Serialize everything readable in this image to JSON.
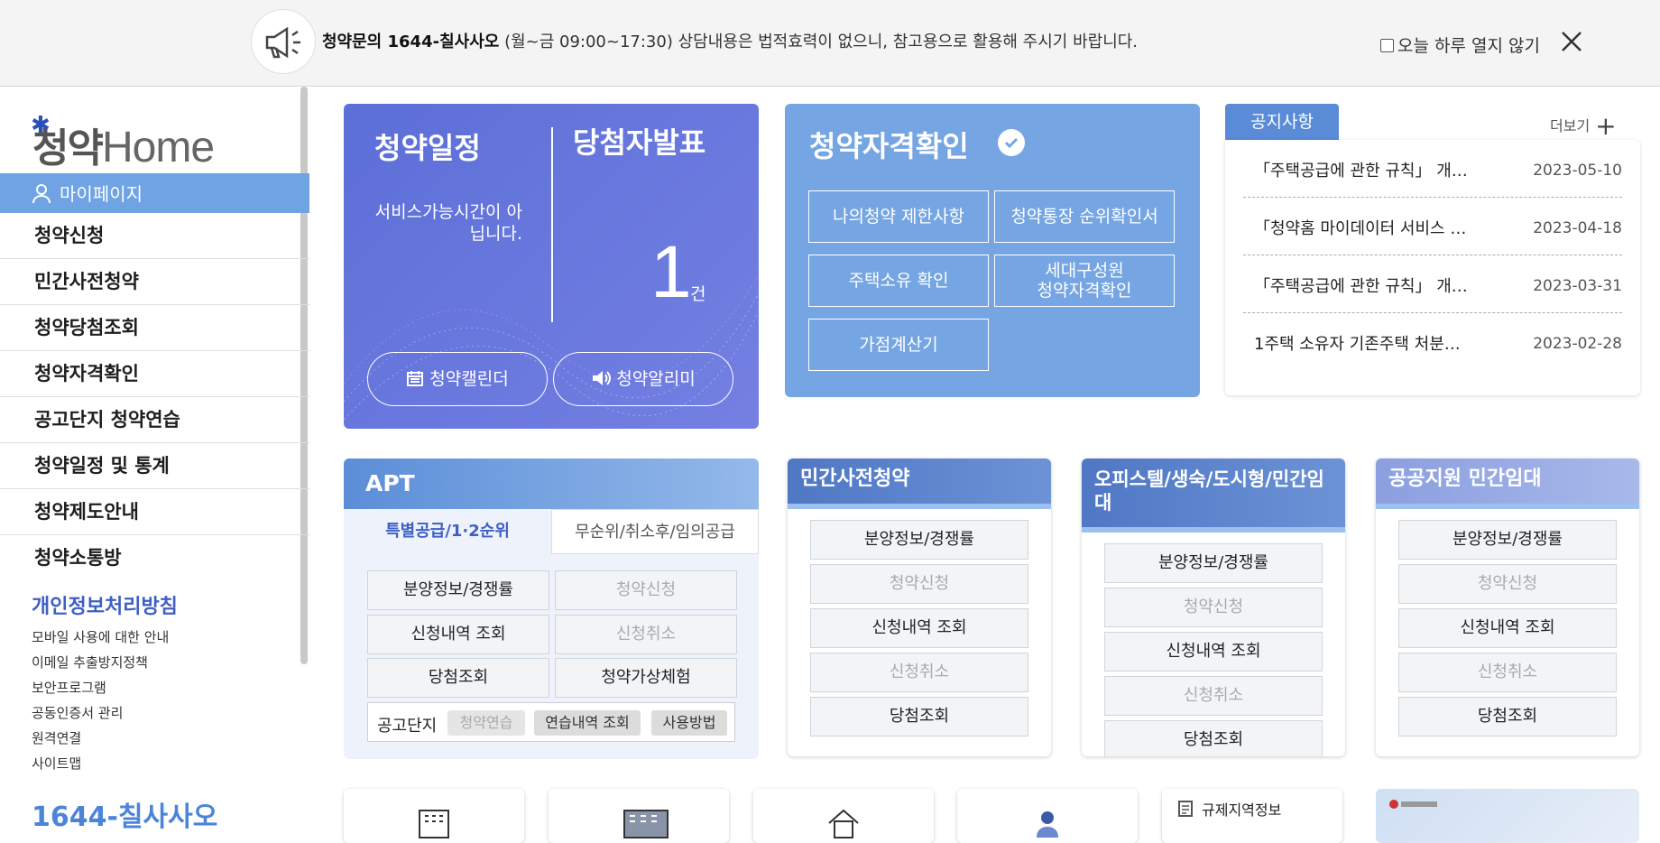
{
  "notice_bar": {
    "bold": "청약문의 1644-칠사사오",
    "hours": "(월~금 09:00~17:30)",
    "rest": " 상담내용은 법적효력이 없으니, 참고용으로 활용해 주시기 바랍니다.",
    "no_show_label": "오늘 하루 열지 않기"
  },
  "sidebar": {
    "logo_part1": "청약",
    "logo_part2": "Home",
    "mypage": "마이페이지",
    "items": [
      "청약신청",
      "민간사전청약",
      "청약당첨조회",
      "청약자격확인",
      "공고단지 청약연습",
      "청약일정 및 통계",
      "청약제도안내",
      "청약소통방"
    ],
    "policy": "개인정보처리방침",
    "links": [
      "모바일 사용에 대한 안내",
      "이메일 추출방지정책",
      "보안프로그램",
      "공동인증서 관리",
      "원격연결",
      "사이트맵"
    ],
    "phone": "1644-칠사사오"
  },
  "schedule_card": {
    "title": "청약일정",
    "winner_title": "당첨자발표",
    "message": "서비스가능시간이 아닙니다.",
    "count": "1",
    "count_unit": "건",
    "calendar_btn": "청약캘린더",
    "alarm_btn": "청약알리미"
  },
  "qualification_card": {
    "title": "청약자격확인",
    "buttons": [
      "나의청약 제한사항",
      "청약통장 순위확인서",
      "주택소유 확인",
      "세대구성원\n청약자격확인",
      "가점계산기"
    ]
  },
  "notices": {
    "tab": "공지사항",
    "more": "더보기",
    "items": [
      {
        "title": "「주택공급에 관한 규칙」 개…",
        "date": "2023-05-10"
      },
      {
        "title": "「청약홈 마이데이터 서비스 …",
        "date": "2023-04-18"
      },
      {
        "title": "「주택공급에 관한 규칙」 개…",
        "date": "2023-03-31"
      },
      {
        "title": "1주택 소유자 기존주택 처분…",
        "date": "2023-02-28"
      }
    ]
  },
  "apt": {
    "title": "APT",
    "tab_active": "특별공급/1·2순위",
    "tab_inactive": "무순위/취소후/임의공급",
    "buttons": [
      "분양정보/경쟁률",
      "청약신청",
      "신청내역 조회",
      "신청취소",
      "당첨조회",
      "청약가상체험"
    ],
    "sub_label": "공고단지",
    "sub_buttons": [
      "청약연습",
      "연습내역 조회",
      "사용방법"
    ]
  },
  "private_pre": {
    "title": "민간사전청약",
    "buttons": [
      "분양정보/경쟁률",
      "청약신청",
      "신청내역 조회",
      "신청취소",
      "당첨조회"
    ]
  },
  "officetel": {
    "title": "오피스텔/생숙/도시형/민간임대",
    "buttons": [
      "분양정보/경쟁률",
      "청약신청",
      "신청내역 조회",
      "신청취소",
      "당첨조회"
    ]
  },
  "public_rental": {
    "title": "공공지원 민간임대",
    "buttons": [
      "분양정보/경쟁률",
      "청약신청",
      "신청내역 조회",
      "신청취소",
      "당첨조회"
    ]
  },
  "quick_links": {
    "regulation": "규제지역정보"
  },
  "colors": {
    "schedule_bg": "#5c6fd8",
    "qualification_bg": "#75a5e2",
    "accent_blue": "#3e5fc6",
    "mypage_bg": "#6fa3e3"
  }
}
